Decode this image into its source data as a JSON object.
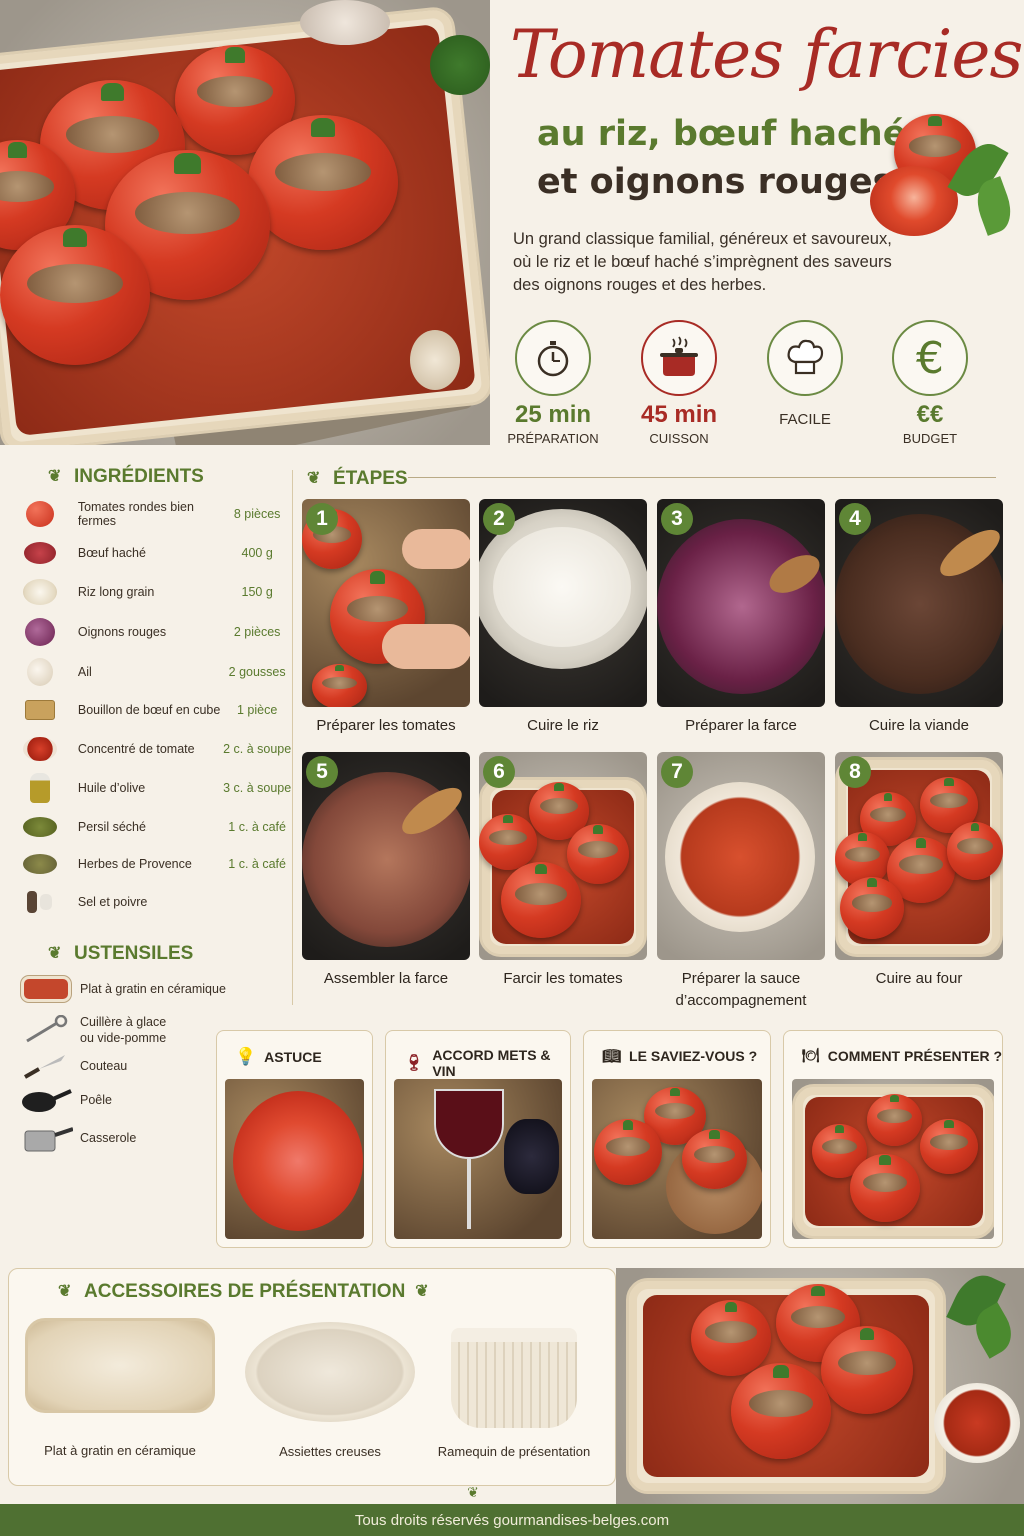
{
  "header": {
    "title": "Tomates farcies",
    "subtitle_line1": "au riz, bœuf haché",
    "subtitle_line2": "et oignons rouges",
    "intro": "Un grand classique familial, généreux et savoureux, où le riz et le bœuf haché s’imprègnent des saveurs des oignons rouges et des herbes."
  },
  "stats": [
    {
      "icon": "stopwatch-icon",
      "value": "25 min",
      "label": "PRÉPARATION"
    },
    {
      "icon": "cooking-pot-icon",
      "value": "45 min",
      "label": "CUISSON"
    },
    {
      "icon": "chef-hat-icon",
      "value": "",
      "label": "FACILE"
    },
    {
      "icon": "euro-icon",
      "value": "€€",
      "label": "BUDGET"
    }
  ],
  "ingredients": {
    "heading": "INGRÉDIENTS",
    "items": [
      {
        "name": "Tomates rondes bien fermes",
        "qty": "8 pièces",
        "icon": "tomato-icon"
      },
      {
        "name": "Bœuf haché",
        "qty": "400 g",
        "icon": "ground-beef-icon"
      },
      {
        "name": "Riz long grain",
        "qty": "150 g",
        "icon": "rice-icon"
      },
      {
        "name": "Oignons rouges",
        "qty": "2 pièces",
        "icon": "red-onion-icon"
      },
      {
        "name": "Ail",
        "qty": "2 gousses",
        "icon": "garlic-icon"
      },
      {
        "name": "Bouillon de bœuf en cube",
        "qty": "1 pièce",
        "icon": "stock-cube-icon"
      },
      {
        "name": "Concentré de tomate",
        "qty": "2 c. à soupe",
        "icon": "tomato-paste-icon"
      },
      {
        "name": "Huile d’olive",
        "qty": "3 c. à soupe",
        "icon": "olive-oil-icon"
      },
      {
        "name": "Persil séché",
        "qty": "1 c. à café",
        "icon": "dried-parsley-icon"
      },
      {
        "name": "Herbes de Provence",
        "qty": "1 c. à café",
        "icon": "herbs-icon"
      },
      {
        "name": "Sel et poivre",
        "qty": "",
        "icon": "salt-pepper-icon"
      }
    ]
  },
  "utensils": {
    "heading": "USTENSILES",
    "items": [
      {
        "name": "Plat à gratin en céramique",
        "icon": "baking-dish-icon"
      },
      {
        "name": "Cuillère à glace\nou vide-pomme",
        "icon": "scoop-icon"
      },
      {
        "name": "Couteau",
        "icon": "knife-icon"
      },
      {
        "name": "Poêle",
        "icon": "frying-pan-icon"
      },
      {
        "name": "Casserole",
        "icon": "saucepan-icon"
      }
    ]
  },
  "steps": {
    "heading": "ÉTAPES",
    "items": [
      {
        "num": "1",
        "label": "Préparer les tomates"
      },
      {
        "num": "2",
        "label": "Cuire le riz"
      },
      {
        "num": "3",
        "label": "Préparer la farce"
      },
      {
        "num": "4",
        "label": "Cuire la viande"
      },
      {
        "num": "5",
        "label": "Assembler la farce"
      },
      {
        "num": "6",
        "label": "Farcir les tomates"
      },
      {
        "num": "7",
        "label": "Préparer la sauce d’accompagnement"
      },
      {
        "num": "8",
        "label": "Cuire au four"
      }
    ]
  },
  "tips": [
    {
      "label": "ASTUCE",
      "icon": "lightbulb-icon"
    },
    {
      "label": "ACCORD METS & VIN",
      "icon": "wine-glass-icon"
    },
    {
      "label": "LE SAVIEZ-VOUS ?",
      "icon": "open-book-icon"
    },
    {
      "label": "COMMENT PRÉSENTER ?",
      "icon": "serving-cloche-icon"
    }
  ],
  "accessories": {
    "heading": "ACCESSOIRES DE PRÉSENTATION",
    "items": [
      {
        "label": "Plat à gratin en céramique"
      },
      {
        "label": "Assiettes creuses"
      },
      {
        "label": "Ramequin de présentation"
      }
    ]
  },
  "footer": "Tous droits réservés gourmandises-belges.com",
  "colors": {
    "accent_red": "#a82b25",
    "accent_green": "#5a7a2e",
    "footer_bg": "#4f7032",
    "paper": "#f6f1e8"
  }
}
